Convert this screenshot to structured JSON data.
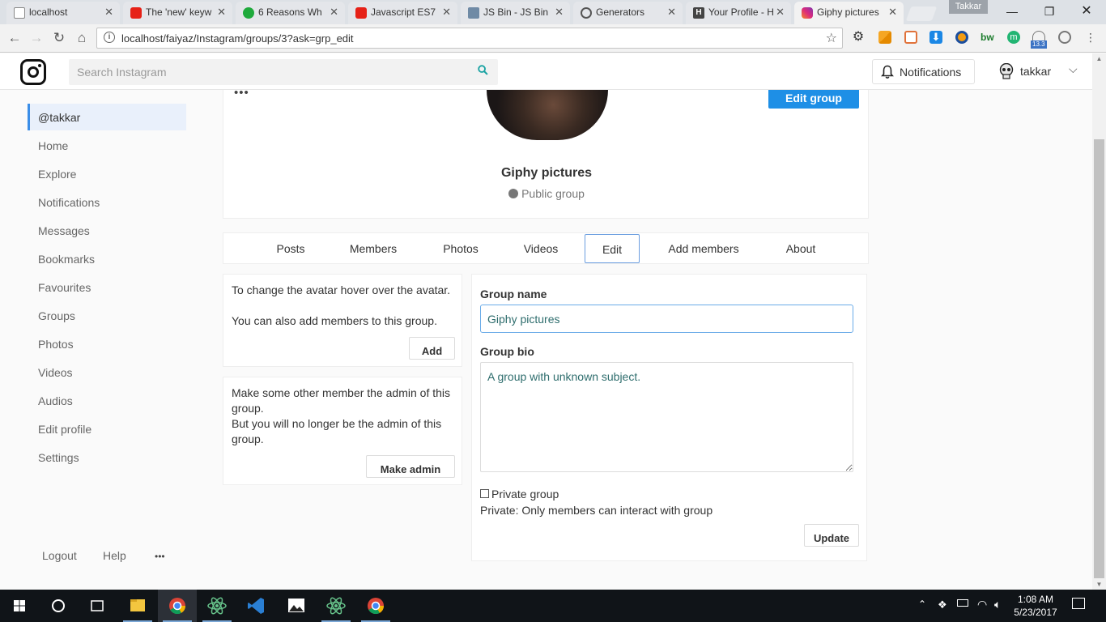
{
  "browser": {
    "tabs": [
      {
        "title": "localhost",
        "color": "#9e9e9e"
      },
      {
        "title": "The 'new' keyw",
        "color": "#e62117"
      },
      {
        "title": "6 Reasons Wh",
        "color": "#1faa3c"
      },
      {
        "title": "Javascript ES7",
        "color": "#e62117"
      },
      {
        "title": "JS Bin - JS Bin",
        "color": "#6f8aa5"
      },
      {
        "title": "Generators",
        "color": "#555555"
      },
      {
        "title": "Your Profile - H",
        "color": "#444444"
      },
      {
        "title": "Giphy pictures",
        "color": "#c13584"
      }
    ],
    "profile_name": "Takkar",
    "url": "localhost/faiyaz/Instagram/groups/3?ask=grp_edit",
    "extension_badge": "13.3"
  },
  "header": {
    "search_placeholder": "Search Instagram",
    "notifications_label": "Notifications",
    "username": "takkar"
  },
  "sidebar": {
    "items": [
      "@takkar",
      "Home",
      "Explore",
      "Notifications",
      "Messages",
      "Bookmarks",
      "Favourites",
      "Groups",
      "Photos",
      "Videos",
      "Audios",
      "Edit profile",
      "Settings"
    ],
    "active": "@takkar",
    "footer": {
      "logout": "Logout",
      "help": "Help",
      "more": "•••"
    }
  },
  "group": {
    "more": "•••",
    "edit_button": "Edit group",
    "name": "Giphy pictures",
    "type": "Public group"
  },
  "group_tabs": [
    "Posts",
    "Members",
    "Photos",
    "Videos",
    "Edit",
    "Add members",
    "About"
  ],
  "active_tab": "Edit",
  "info_cards": {
    "avatar_hint": "To change the avatar hover over the avatar.",
    "add_hint": "You can also add members to this group.",
    "add_button": "Add",
    "admin_hint": "Make some other member the admin of this group.",
    "admin_warning": "But you will no longer be the admin of this group.",
    "admin_button": "Make admin"
  },
  "edit_form": {
    "name_label": "Group name",
    "name_value": "Giphy pictures",
    "bio_label": "Group bio",
    "bio_value": "A group with unknown subject.",
    "private_label": "Private group",
    "private_checked": false,
    "private_note": "Private: Only members can interact with group",
    "update_button": "Update"
  },
  "taskbar": {
    "time": "1:08 AM",
    "date": "5/23/2017"
  },
  "colors": {
    "accent": "#1e8fe6",
    "active_tab_border": "#6b9ee0",
    "input_text": "#2e6d6d"
  }
}
